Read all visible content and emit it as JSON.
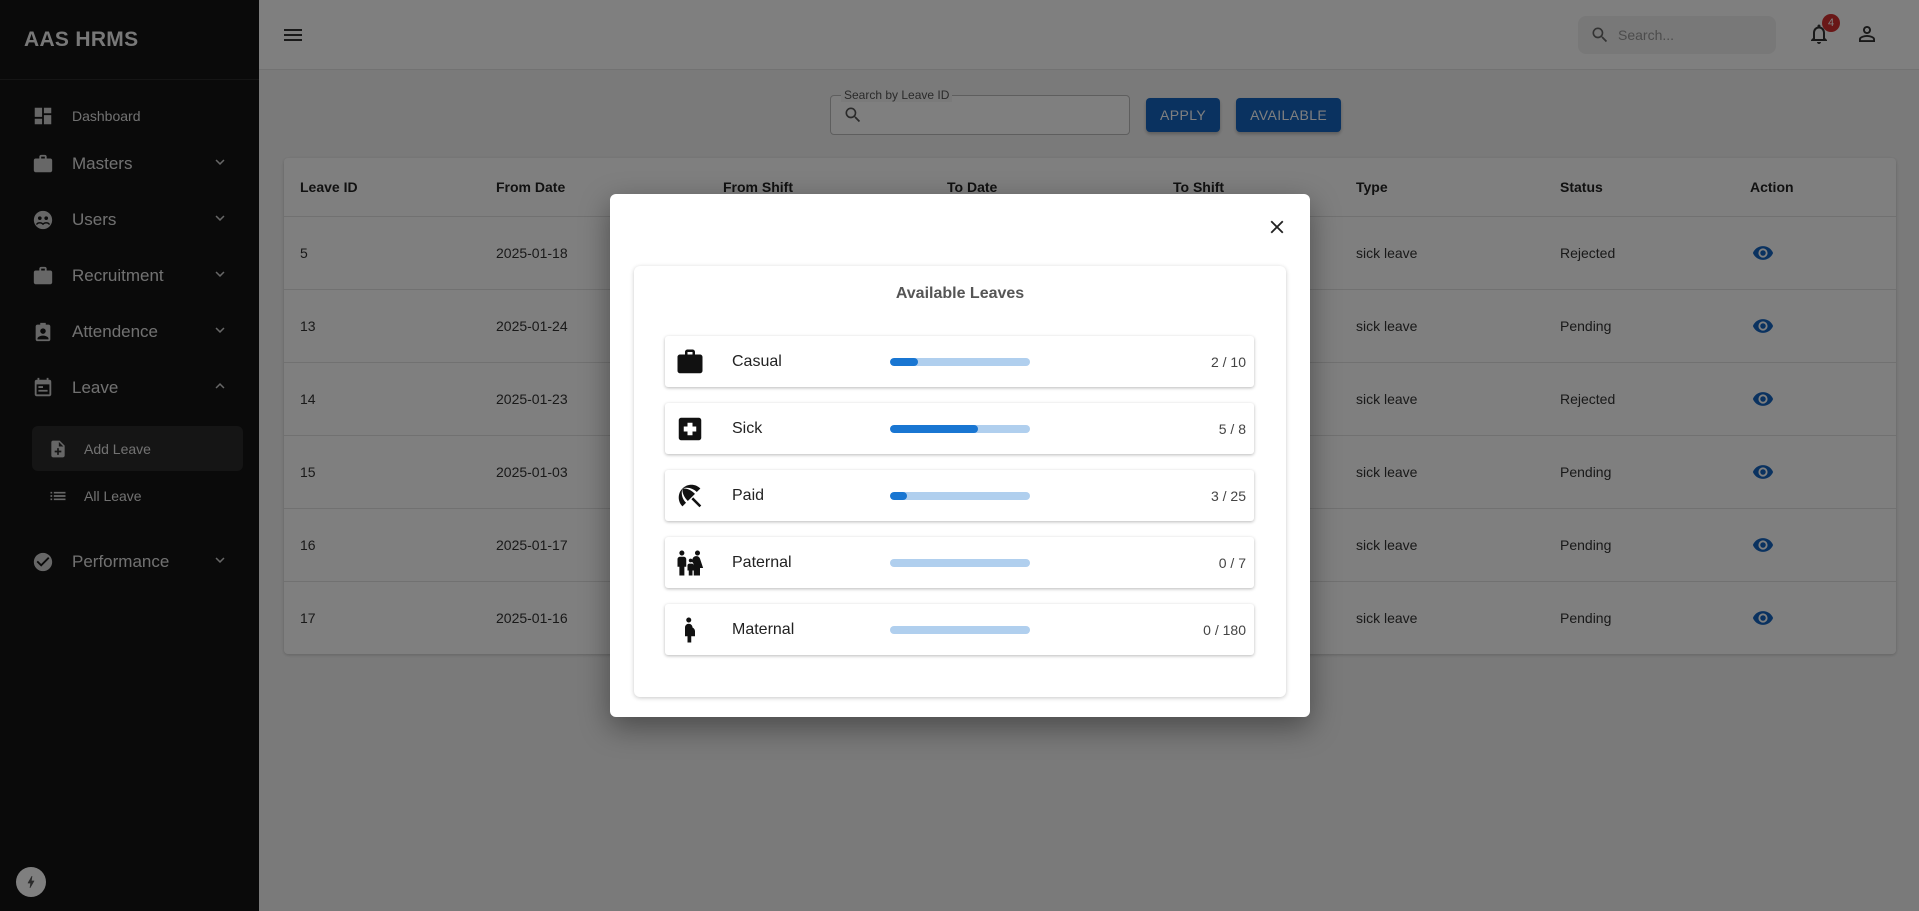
{
  "app": {
    "brand": "AAS HRMS"
  },
  "sidebar": {
    "items": [
      {
        "label": "Dashboard",
        "icon": "dashboard-icon"
      },
      {
        "label": "Masters",
        "icon": "briefcase-icon"
      },
      {
        "label": "Users",
        "icon": "users-icon"
      },
      {
        "label": "Recruitment",
        "icon": "briefcase-icon"
      },
      {
        "label": "Attendence",
        "icon": "id-card-icon"
      },
      {
        "label": "Leave",
        "icon": "calendar-icon"
      },
      {
        "label": "Performance",
        "icon": "check-circle-icon"
      }
    ],
    "leave_sub": [
      {
        "label": "Add Leave",
        "icon": "note-add-icon"
      },
      {
        "label": "All Leave",
        "icon": "list-icon"
      }
    ]
  },
  "topbar": {
    "search_placeholder": "Search...",
    "notification_count": "4"
  },
  "filter": {
    "search_label": "Search by Leave ID",
    "apply_label": "APPLY",
    "available_label": "AVAILABLE"
  },
  "table": {
    "headers": [
      "Leave ID",
      "From Date",
      "From Shift",
      "To Date",
      "To Shift",
      "Type",
      "Status",
      "Action"
    ],
    "rows": [
      {
        "id": "5",
        "from_date": "2025-01-18",
        "type": "sick leave",
        "status": "Rejected"
      },
      {
        "id": "13",
        "from_date": "2025-01-24",
        "type": "sick leave",
        "status": "Pending"
      },
      {
        "id": "14",
        "from_date": "2025-01-23",
        "type": "sick leave",
        "status": "Rejected"
      },
      {
        "id": "15",
        "from_date": "2025-01-03",
        "type": "sick leave",
        "status": "Pending"
      },
      {
        "id": "16",
        "from_date": "2025-01-17",
        "type": "sick leave",
        "status": "Pending"
      },
      {
        "id": "17",
        "from_date": "2025-01-16",
        "type": "sick leave",
        "status": "Pending"
      }
    ]
  },
  "modal": {
    "title": "Available Leaves",
    "leaves": [
      {
        "name": "Casual",
        "used": 2,
        "total": 10,
        "count": "2 / 10",
        "icon": "briefcase-icon"
      },
      {
        "name": "Sick",
        "used": 5,
        "total": 8,
        "count": "5 / 8",
        "icon": "medical-icon"
      },
      {
        "name": "Paid",
        "used": 3,
        "total": 25,
        "count": "3 / 25",
        "icon": "beach-umbrella-icon"
      },
      {
        "name": "Paternal",
        "used": 0,
        "total": 7,
        "count": "0 / 7",
        "icon": "family-icon"
      },
      {
        "name": "Maternal",
        "used": 0,
        "total": 180,
        "count": "0 / 180",
        "icon": "pregnant-woman-icon"
      }
    ]
  },
  "colors": {
    "sidebar_bg": "#141414",
    "primary": "#1565c0",
    "progress_fill": "#1976d2",
    "progress_track": "#b0cfee",
    "badge": "#d32f2f"
  }
}
